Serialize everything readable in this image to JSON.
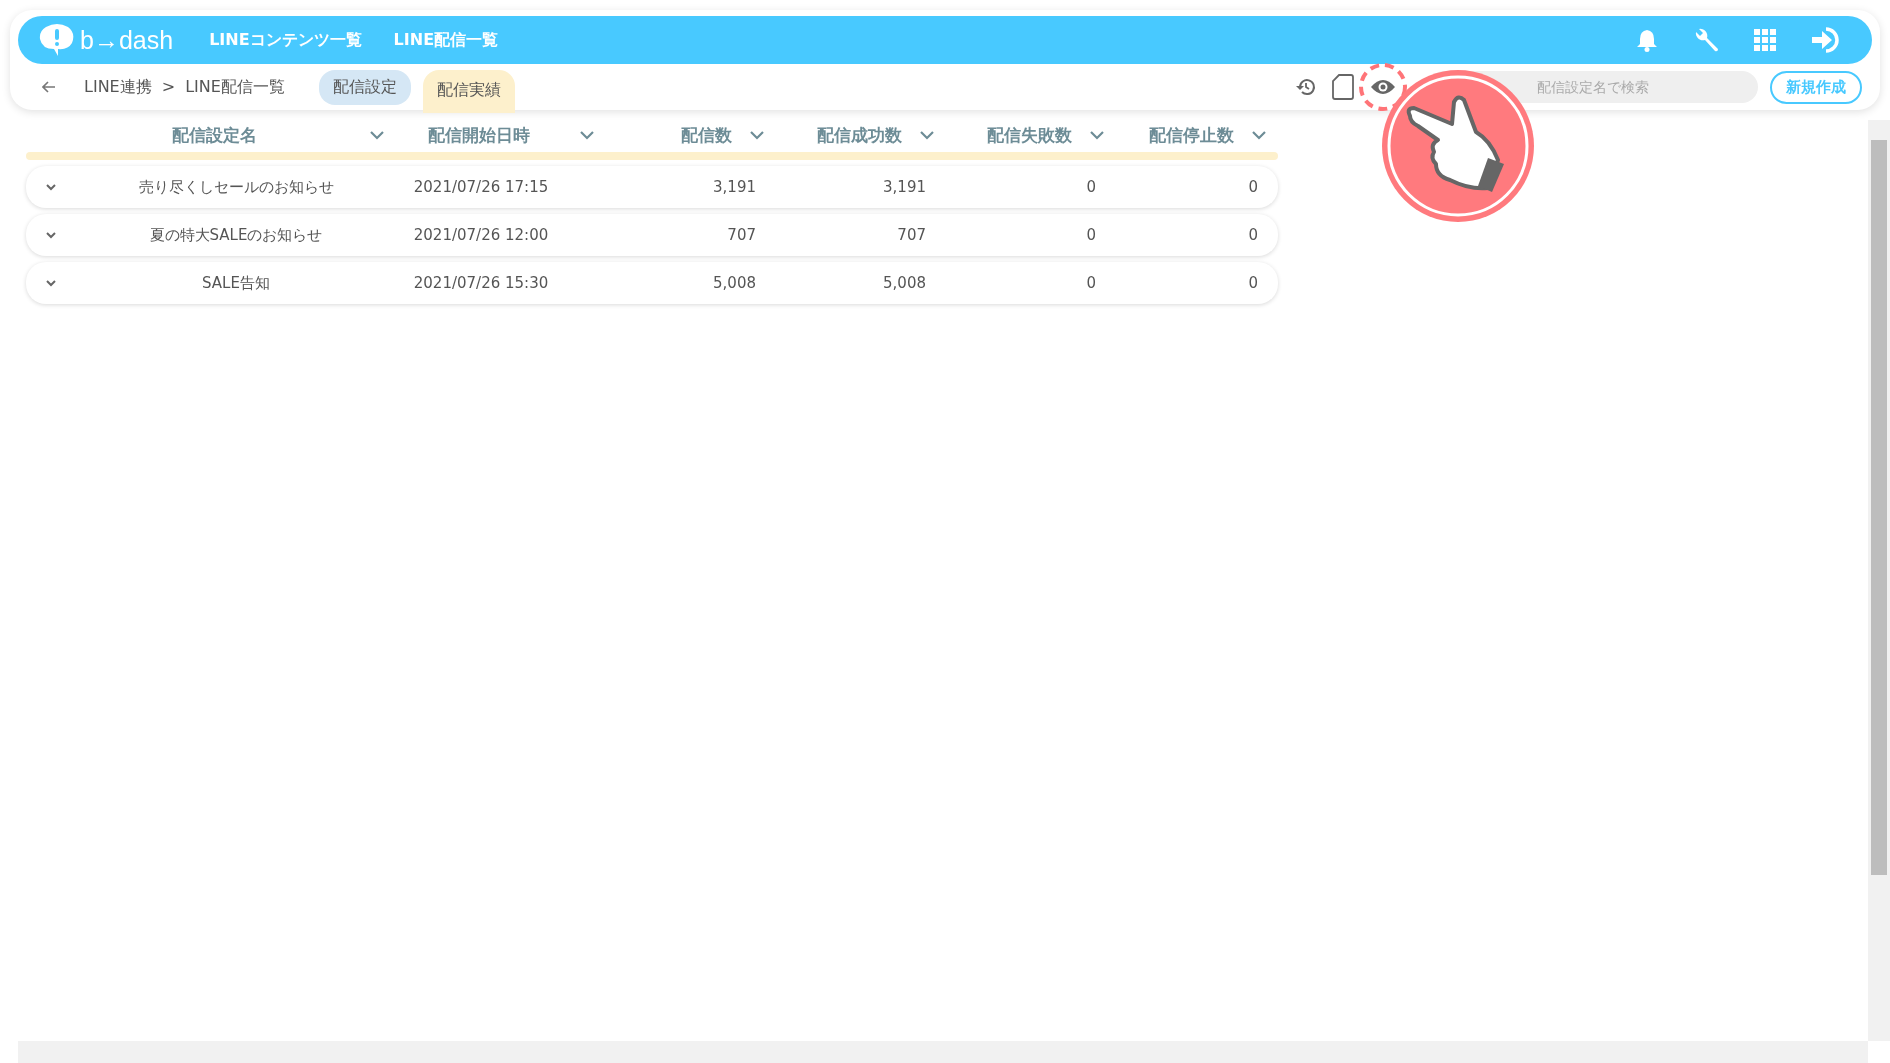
{
  "header": {
    "logo": "b→dash",
    "nav": [
      {
        "label": "LINEコンテンツ一覧"
      },
      {
        "label": "LINE配信一覧"
      }
    ]
  },
  "subbar": {
    "breadcrumb": [
      "LINE連携",
      ">",
      "LINE配信一覧"
    ],
    "tabs": [
      {
        "label": "配信設定",
        "selected": false
      },
      {
        "label": "配信実績",
        "selected": true
      }
    ],
    "search": {
      "placeholder": "配信設定名で検索"
    },
    "create_button": "新規作成"
  },
  "table": {
    "columns": [
      {
        "label": "配信設定名",
        "kind": "text"
      },
      {
        "label": "配信開始日時",
        "kind": "text"
      },
      {
        "label": "配信数",
        "kind": "number"
      },
      {
        "label": "配信成功数",
        "kind": "number"
      },
      {
        "label": "配信失敗数",
        "kind": "number"
      },
      {
        "label": "配信停止数",
        "kind": "number"
      }
    ],
    "rows": [
      {
        "expanded": false,
        "cells": [
          "売り尽くしセールのお知らせ",
          "2021/07/26 17:15",
          "3,191",
          "3,191",
          "0",
          "0"
        ]
      },
      {
        "expanded": false,
        "cells": [
          "夏の特大SALEのお知らせ",
          "2021/07/26 12:00",
          "707",
          "707",
          "0",
          "0"
        ]
      },
      {
        "expanded": false,
        "cells": [
          "SALE告知",
          "2021/07/26 15:30",
          "5,008",
          "5,008",
          "0",
          "0"
        ]
      }
    ]
  }
}
